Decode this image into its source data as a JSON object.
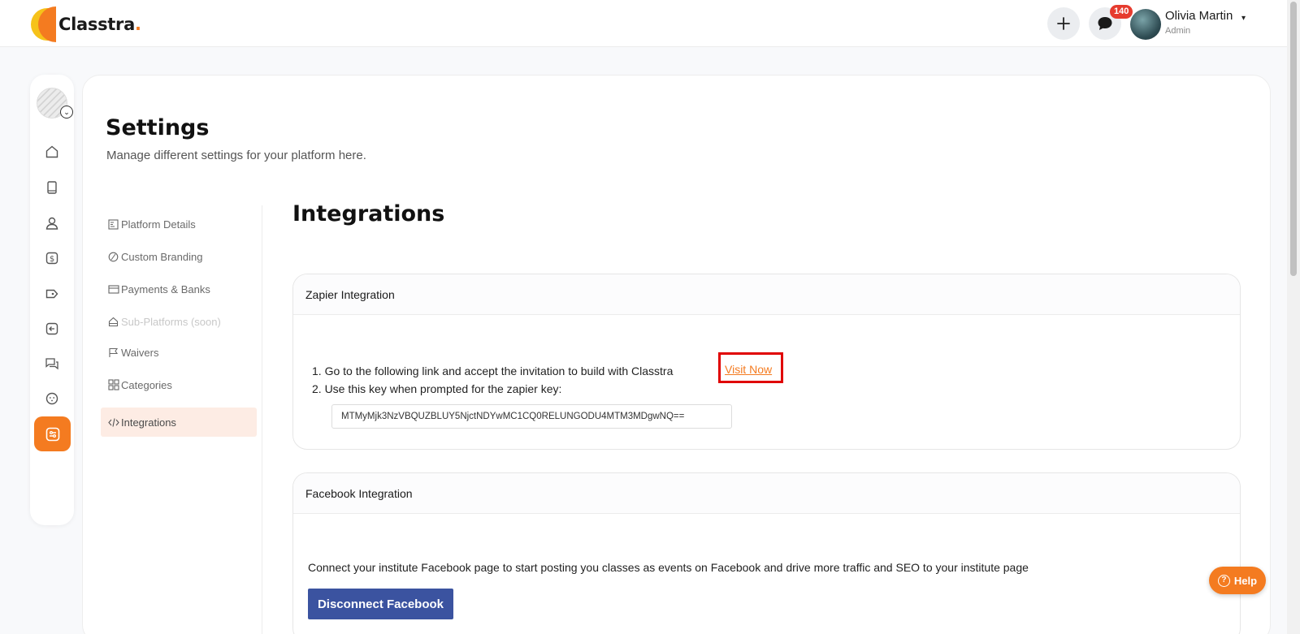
{
  "app": {
    "brand": "Classtra",
    "brand_dot": "."
  },
  "header": {
    "add_icon": "plus-icon",
    "chat_icon": "chat-bubble-icon",
    "notification_count": "140",
    "user_name": "Olivia Martin",
    "user_role": "Admin",
    "caret": "▾"
  },
  "rail": {
    "items": [
      "home-icon",
      "book-icon",
      "user-icon",
      "dollar-icon",
      "tag-icon",
      "exit-icon",
      "messages-icon",
      "smiley-icon",
      "settings-icon"
    ],
    "active": "settings-icon"
  },
  "page": {
    "title": "Settings",
    "subtitle": "Manage different settings for your platform here."
  },
  "settings_nav": [
    {
      "label": "Platform Details",
      "icon": "form-icon"
    },
    {
      "label": "Custom Branding",
      "icon": "palette-icon"
    },
    {
      "label": "Payments & Banks",
      "icon": "card-icon"
    },
    {
      "label": "Sub-Platforms (soon)",
      "icon": "home-icon",
      "disabled": true
    },
    {
      "label": "Waivers",
      "icon": "flag-icon"
    },
    {
      "label": "Categories",
      "icon": "grid-icon"
    },
    {
      "label": "Integrations",
      "icon": "code-icon",
      "active": true
    }
  ],
  "integrations": {
    "title": "Integrations",
    "zapier": {
      "title": "Zapier Integration",
      "step1": "1. Go to the following link and accept the invitation to build with Classtra",
      "link": "Visit Now",
      "step2": "2. Use this key when prompted for the zapier key:",
      "key": "MTMyMjk3NzVBQUZBLUY5NjctNDYwMC1CQ0RELUNGODU4MTM3MDgwNQ=="
    },
    "facebook": {
      "title": "Facebook Integration",
      "description": "Connect your institute Facebook page to start posting you classes as events on Facebook and drive more traffic and SEO to your institute page",
      "button": "Disconnect Facebook"
    }
  },
  "help": {
    "label": "Help",
    "glyph": "?"
  },
  "colors": {
    "accent": "#f47b20",
    "facebook": "#3b53a0",
    "badge": "#e63b2e",
    "highlight": "#e00000"
  }
}
